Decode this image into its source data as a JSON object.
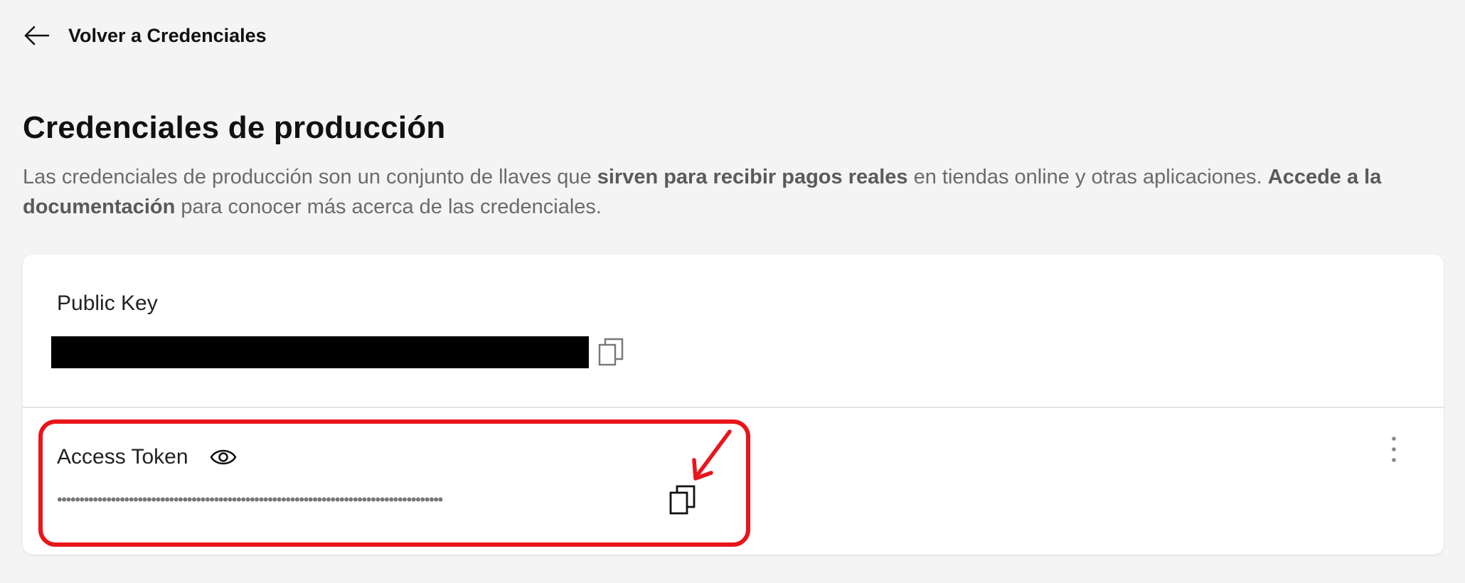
{
  "nav": {
    "back_icon": "arrow-left-icon",
    "back_label": "Volver a Credenciales"
  },
  "page": {
    "title": "Credenciales de producción",
    "description": {
      "part1": "Las credenciales de producción son un conjunto de llaves que ",
      "bold1": "sirven para recibir pagos reales",
      "part2": " en tiendas online y otras aplicaciones. ",
      "link": "Accede a la documentación",
      "part3": " para conocer más acerca de las credenciales."
    }
  },
  "public_key": {
    "label": "Public Key",
    "value_redacted": true,
    "copy_icon": "copy-icon"
  },
  "access_token": {
    "label": "Access Token",
    "visibility_icon": "eye-icon",
    "masked_value": "••••••••••••••••••••••••••••••••••••••••••••••••••••••••••••••••••••••••••••••••••••••",
    "copy_icon": "copy-icon",
    "menu_icon": "more-vertical-icon"
  },
  "annotation": {
    "color": "#e8151b",
    "arrow_icon": "red-arrow-annotation"
  }
}
